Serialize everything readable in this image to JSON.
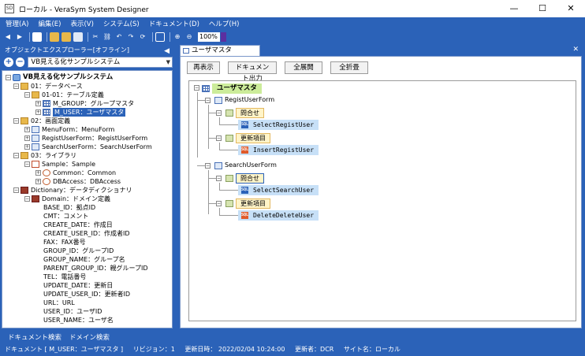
{
  "window": {
    "title": "ローカル - VeraSym System Designer",
    "icon_text": "SD"
  },
  "window_controls": {
    "minimize": "—",
    "maximize": "☐",
    "close": "✕"
  },
  "menu": [
    "管理(A)",
    "編集(E)",
    "表示(V)",
    "システム(S)",
    "ドキュメント(D)",
    "ヘルプ(H)"
  ],
  "toolbar": {
    "zoom": "100%"
  },
  "explorer": {
    "header": "オブジェクトエクスプローラー[オフライン]",
    "collapse_icon": "◀",
    "system_combo": "VB見える化サンプルシステム",
    "tree": [
      {
        "label": "VB見える化サンプルシステム",
        "exp": "－",
        "icon": "system",
        "level": 0
      },
      {
        "label": "01：データベース",
        "exp": "－",
        "icon": "folder",
        "level": 1
      },
      {
        "label": "01-01：テーブル定義",
        "exp": "－",
        "icon": "folder",
        "level": 2
      },
      {
        "label": "M_GROUP：グループマスタ",
        "exp": "＋",
        "icon": "table",
        "level": 3
      },
      {
        "label": "M_USER：ユーザマスタ",
        "exp": "＋",
        "icon": "table",
        "level": 3,
        "selected": true
      },
      {
        "label": "02：画面定義",
        "exp": "－",
        "icon": "folder",
        "level": 1
      },
      {
        "label": "MenuForm：MenuForm",
        "exp": "＋",
        "icon": "form",
        "level": 2
      },
      {
        "label": "RegistUserForm：RegistUserForm",
        "exp": "＋",
        "icon": "form",
        "level": 2
      },
      {
        "label": "SearchUserForm：SearchUserForm",
        "exp": "＋",
        "icon": "form",
        "level": 2
      },
      {
        "label": "03：ライブラリ",
        "exp": "－",
        "icon": "folder",
        "level": 1
      },
      {
        "label": "Sample：Sample",
        "exp": "－",
        "icon": "lib",
        "level": 2
      },
      {
        "label": "Common：Common",
        "exp": "＋",
        "icon": "class",
        "level": 3
      },
      {
        "label": "DBAccess：DBAccess",
        "exp": "＋",
        "icon": "class",
        "level": 3
      },
      {
        "label": "Dictionary：データディクショナリ",
        "exp": "－",
        "icon": "dict",
        "level": 1
      },
      {
        "label": "Domain：ドメイン定義",
        "exp": "－",
        "icon": "dict",
        "level": 2
      },
      {
        "label": "BASE_ID：拠点ID",
        "exp": "",
        "icon": "",
        "level": 3
      },
      {
        "label": "CMT：コメント",
        "exp": "",
        "icon": "",
        "level": 3
      },
      {
        "label": "CREATE_DATE：作成日",
        "exp": "",
        "icon": "",
        "level": 3
      },
      {
        "label": "CREATE_USER_ID：作成者ID",
        "exp": "",
        "icon": "",
        "level": 3
      },
      {
        "label": "FAX：FAX番号",
        "exp": "",
        "icon": "",
        "level": 3
      },
      {
        "label": "GROUP_ID：グループID",
        "exp": "",
        "icon": "",
        "level": 3
      },
      {
        "label": "GROUP_NAME：グループ名",
        "exp": "",
        "icon": "",
        "level": 3
      },
      {
        "label": "PARENT_GROUP_ID：親グループID",
        "exp": "",
        "icon": "",
        "level": 3
      },
      {
        "label": "TEL：電話番号",
        "exp": "",
        "icon": "",
        "level": 3
      },
      {
        "label": "UPDATE_DATE：更新日",
        "exp": "",
        "icon": "",
        "level": 3
      },
      {
        "label": "UPDATE_USER_ID：更新者ID",
        "exp": "",
        "icon": "",
        "level": 3
      },
      {
        "label": "URL：URL",
        "exp": "",
        "icon": "",
        "level": 3
      },
      {
        "label": "USER_ID：ユーザID",
        "exp": "",
        "icon": "",
        "level": 3
      },
      {
        "label": "USER_NAME：ユーザ名",
        "exp": "",
        "icon": "",
        "level": 3
      }
    ]
  },
  "document": {
    "tab_label": "ユーザマスタ",
    "tab_close": "✕",
    "buttons": [
      "再表示",
      "ドキュメント出力",
      "全展開",
      "全折畳"
    ],
    "diagram": {
      "root": "ユーザマスタ",
      "forms": [
        {
          "name": "RegistUserForm",
          "query_label": "問合せ",
          "query_sql": "SelectRegistUser",
          "update_label": "更新項目",
          "update_sql": "InsertRegistUser"
        },
        {
          "name": "SearchUserForm",
          "query_label": "問合せ",
          "query_sql": "SelectSearchUser",
          "update_label": "更新項目",
          "update_sql": "DeleteDeleteUser"
        }
      ],
      "sql_icon_text": "SQL"
    }
  },
  "bottom_tabs": [
    "ドキュメント検索",
    "ドメイン検索"
  ],
  "status": {
    "doc": "ドキュメント [ M_USER：ユーザマスタ ]",
    "revision": "リビジョン：1",
    "updated": "更新日時： 2022/02/04 10:24:00",
    "updater": "更新者：DCR",
    "site": "サイト名：ローカル"
  },
  "colors": {
    "accent": "#2b62b8",
    "query": "#fff4c8",
    "sql": "#c7e0f7",
    "master": "#ccec9a"
  }
}
